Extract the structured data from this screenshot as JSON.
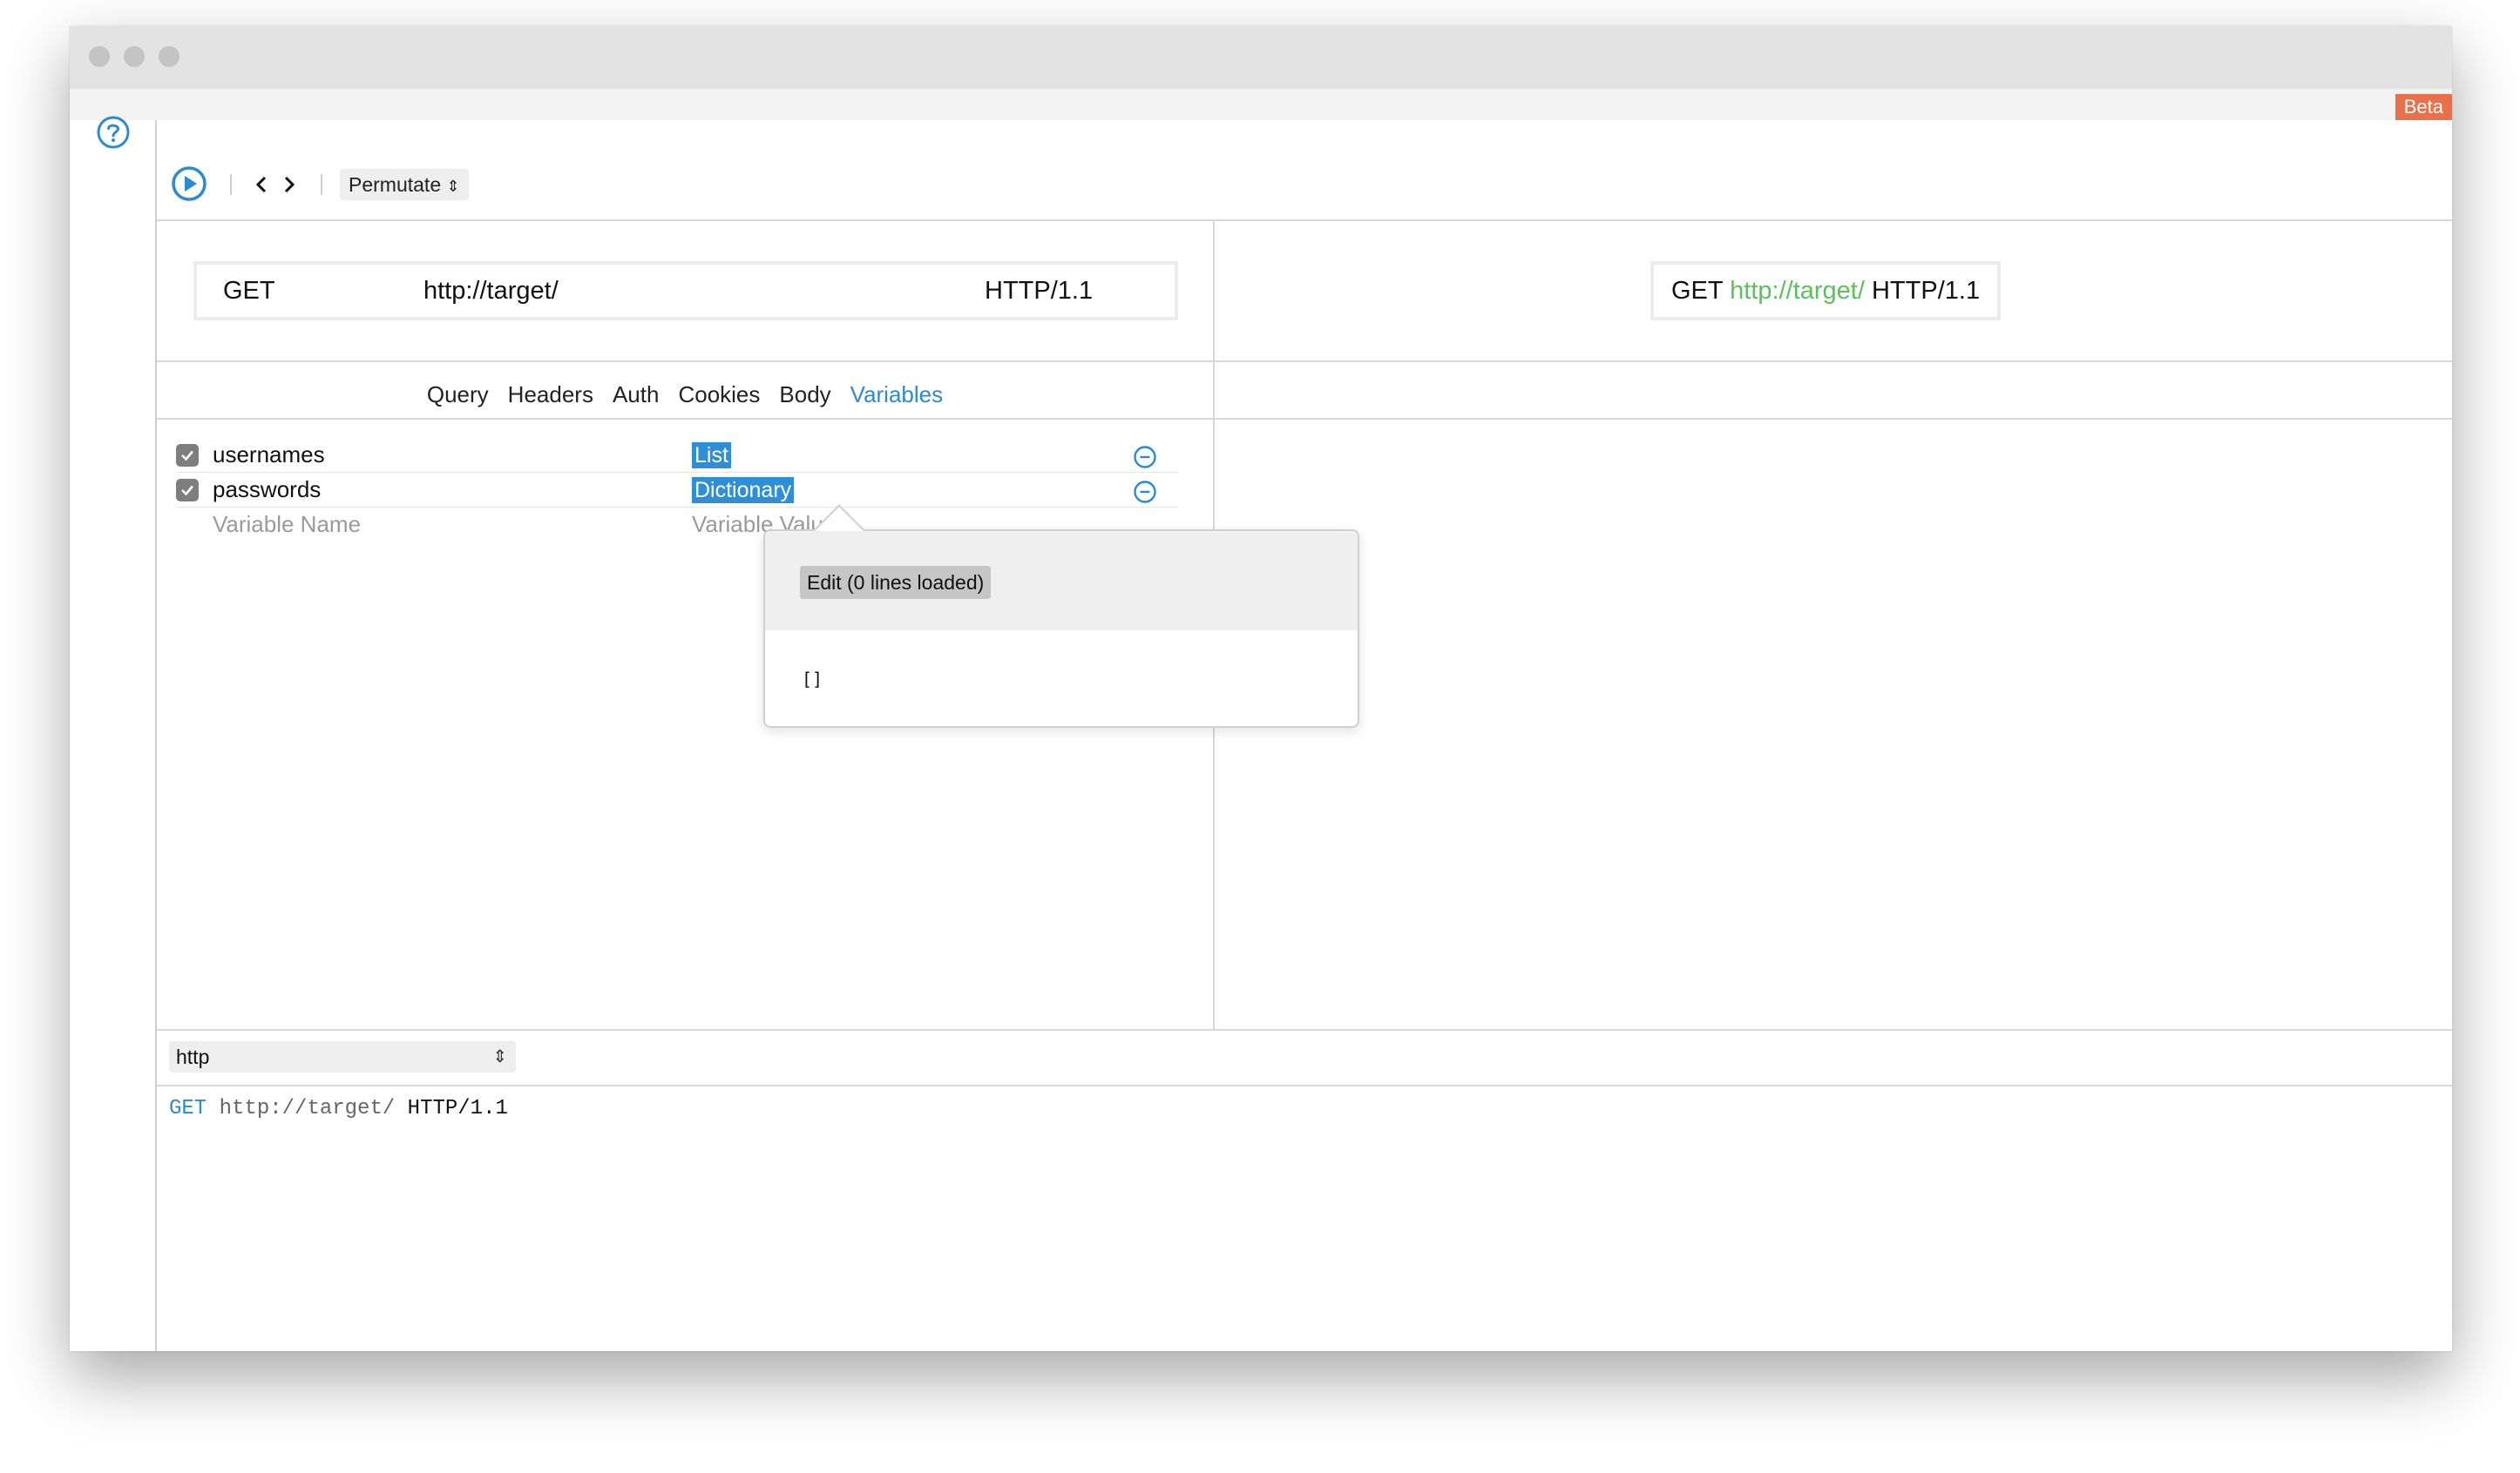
{
  "window": {
    "beta_badge": "Beta"
  },
  "toolbar": {
    "mode": "Permutate"
  },
  "request": {
    "method": "GET",
    "url": "http://target/",
    "protocol": "HTTP/1.1"
  },
  "preview": {
    "method": "GET",
    "url": "http://target/",
    "protocol": "HTTP/1.1"
  },
  "tabs": [
    {
      "label": "Query"
    },
    {
      "label": "Headers"
    },
    {
      "label": "Auth"
    },
    {
      "label": "Cookies"
    },
    {
      "label": "Body"
    },
    {
      "label": "Variables",
      "active": true
    }
  ],
  "variables": {
    "rows": [
      {
        "name": "usernames",
        "type": "List",
        "checked": true
      },
      {
        "name": "passwords",
        "type": "Dictionary",
        "checked": true
      }
    ],
    "name_placeholder": "Variable Name",
    "value_placeholder": "Variable Value"
  },
  "popover": {
    "edit_label": "Edit (0 lines loaded)",
    "content": "[]"
  },
  "output": {
    "format": "http",
    "method": "GET",
    "url": "http://target/",
    "protocol": "HTTP/1.1"
  },
  "colors": {
    "accent": "#2b8bd0",
    "beta": "#e8704a",
    "url_green": "#5cc05c"
  }
}
